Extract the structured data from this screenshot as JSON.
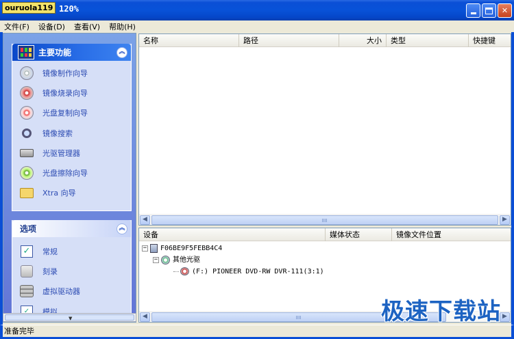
{
  "window": {
    "title_suffix": "120%",
    "user_label": "ouruola119"
  },
  "menu": [
    {
      "label": "文件(F)"
    },
    {
      "label": "设备(D)"
    },
    {
      "label": "查看(V)"
    },
    {
      "label": "帮助(H)"
    }
  ],
  "task_pane": {
    "main_group": {
      "title": "主要功能",
      "items": [
        {
          "label": "镜像制作向导",
          "icon": "disc-folder-icon"
        },
        {
          "label": "镜像烧录向导",
          "icon": "disc-burn-icon"
        },
        {
          "label": "光盘复制向导",
          "icon": "disc-copy-icon"
        },
        {
          "label": "镜像搜索",
          "icon": "image-search-icon"
        },
        {
          "label": "光驱管理器",
          "icon": "drive-manager-icon"
        },
        {
          "label": "光盘擦除向导",
          "icon": "disc-erase-icon"
        },
        {
          "label": "Xtra 向导",
          "icon": "xtra-wizard-icon"
        }
      ]
    },
    "options_group": {
      "title": "选项",
      "items": [
        {
          "label": "常规",
          "icon": "general-check-icon"
        },
        {
          "label": "刻录",
          "icon": "burn-options-icon"
        },
        {
          "label": "虚拟驱动器",
          "icon": "virtual-drive-icon"
        },
        {
          "label": "模拟",
          "icon": "emulation-icon"
        }
      ]
    }
  },
  "file_list": {
    "columns": [
      "名称",
      "路径",
      "大小",
      "类型",
      "快捷键"
    ]
  },
  "device_list": {
    "columns": [
      "设备",
      "媒体状态",
      "镜像文件位置"
    ],
    "tree": {
      "root": "F06BE9F5FEBB4C4",
      "group": "其他光驱",
      "drive": "(F:) PIONEER DVD-RW  DVR-111(3:1)"
    }
  },
  "status": {
    "text": "准备完毕"
  },
  "watermark": {
    "text": "极速下载站"
  },
  "colors": {
    "titlebar_blue": "#0852d8",
    "task_link": "#2d4cb3",
    "watermark_blue": "#1d63c2"
  }
}
